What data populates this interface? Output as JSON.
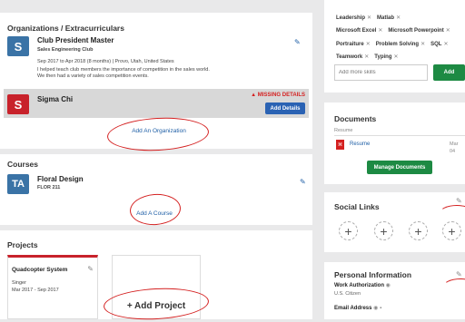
{
  "organizations": {
    "title": "Organizations / Extracurriculars",
    "items": [
      {
        "initial": "S",
        "name": "Club President Master",
        "sub": "Sales Engineering Club",
        "dates": "Sep 2017 to Apr 2018 (8 months) | Provo, Utah, United States",
        "desc1": "I helped teach club members the importance of competition in the sales world.",
        "desc2": "We then had a variety of sales competition events."
      },
      {
        "initial": "S",
        "name": "Sigma Chi",
        "warning": "MISSING DETAILS",
        "action": "Add Details"
      }
    ],
    "add_label": "Add An Organization"
  },
  "courses": {
    "title": "Courses",
    "items": [
      {
        "initial": "TA",
        "name": "Floral Design",
        "code": "FLOR 211"
      }
    ],
    "add_label": "Add A Course"
  },
  "projects": {
    "title": "Projects",
    "items": [
      {
        "name": "Quadcopter System",
        "role": "Singer",
        "dates": "Mar 2017 - Sep 2017"
      }
    ],
    "add_label": "+ Add Project"
  },
  "skills": {
    "rows": [
      [
        "Leadership",
        "Matlab"
      ],
      [
        "Microsoft Excel",
        "Microsoft Powerpoint"
      ],
      [
        "Portraiture",
        "Problem Solving",
        "SQL"
      ],
      [
        "Teamwork",
        "Typing"
      ]
    ],
    "placeholder": "Add more skills",
    "add_label": "Add"
  },
  "documents": {
    "title": "Documents",
    "section": "Resume",
    "file": "Resume",
    "date": "Mar 04",
    "manage_label": "Manage Documents"
  },
  "social": {
    "title": "Social Links",
    "plus": "+"
  },
  "personal": {
    "title": "Personal Information",
    "work_label": "Work Authorization",
    "work_value": "U.S. Citizen",
    "email_label": "Email Address"
  },
  "colors": {
    "blue": "#1f5fa6",
    "red": "#c8222b",
    "green": "#1d8a43",
    "teal": "#3a73a6"
  }
}
